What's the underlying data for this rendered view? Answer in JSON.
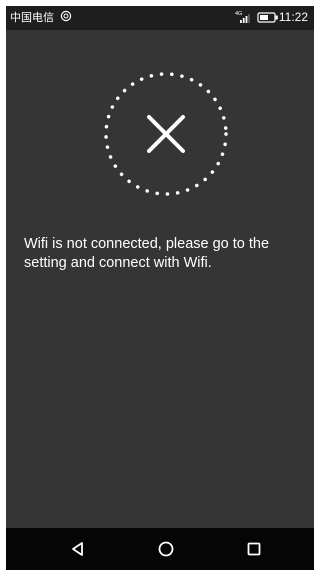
{
  "status_bar": {
    "carrier": "中国电信",
    "signal_badge": "4G",
    "time": "11:22",
    "icons": [
      "data-ring-icon",
      "signal-icon",
      "battery-icon"
    ]
  },
  "main": {
    "status_icon": "close-icon",
    "message": "Wifi is not connected, please go to the setting and connect with Wifi."
  },
  "nav_bar": {
    "icons": [
      "back-icon",
      "home-icon",
      "recents-icon"
    ]
  },
  "colors": {
    "background": "#353535",
    "status_bar": "#1e1e1e",
    "nav_bar": "#050505",
    "text": "#ffffff"
  }
}
